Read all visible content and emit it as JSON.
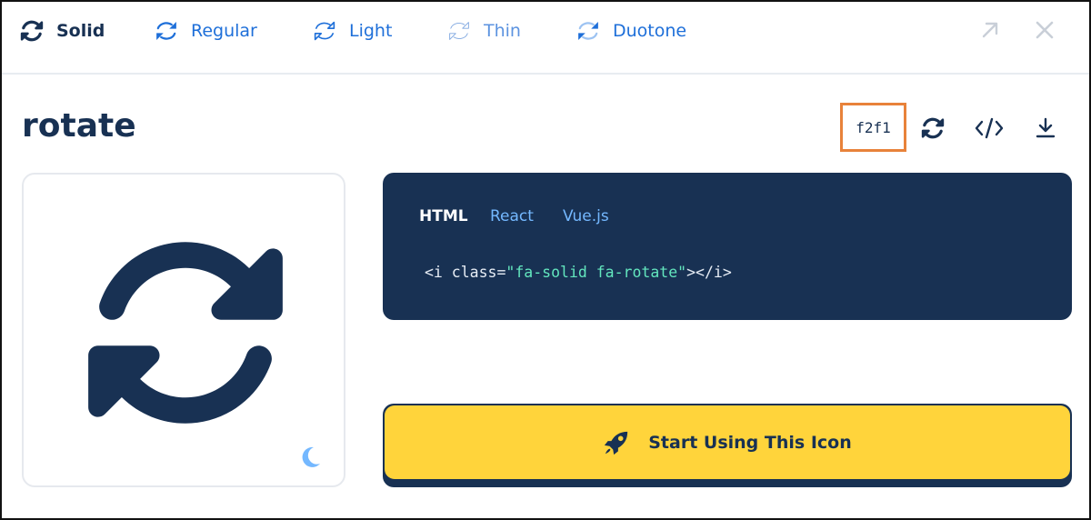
{
  "style_tabs": [
    {
      "label": "Solid",
      "icon": "rotate-solid-icon"
    },
    {
      "label": "Regular",
      "icon": "rotate-regular-icon"
    },
    {
      "label": "Light",
      "icon": "rotate-light-icon"
    },
    {
      "label": "Thin",
      "icon": "rotate-thin-icon"
    },
    {
      "label": "Duotone",
      "icon": "rotate-duotone-icon"
    }
  ],
  "active_style": "Solid",
  "icon_name": "rotate",
  "unicode": "f2f1",
  "tools": [
    "rotate-icon",
    "code-icon",
    "download-icon"
  ],
  "code": {
    "tabs": [
      "HTML",
      "React",
      "Vue.js"
    ],
    "active_tab": "HTML",
    "prefix": "<i class=",
    "class_value": "\"fa-solid fa-rotate\"",
    "suffix": "></i>"
  },
  "start_button": {
    "label": "Start Using This Icon",
    "icon": "rocket-icon"
  },
  "colors": {
    "navy": "#183153",
    "blue": "#1e6fd9",
    "yellow": "#ffd43b",
    "highlight": "#e8823a",
    "code_string": "#63e6be"
  }
}
